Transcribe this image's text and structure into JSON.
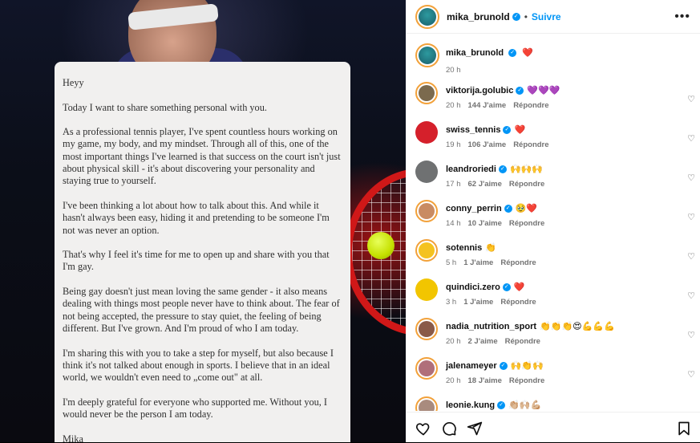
{
  "letter": {
    "greeting": "Heyy",
    "paragraphs": [
      "Today I want to share something personal with you.",
      "As a professional tennis player, I've spent countless hours working on my game, my body, and my mindset. Through all of this, one of the most important things I've learned is that success on the court isn't just about physical skill - it's about discovering your personality and staying true to yourself.",
      "I've been thinking a lot about how to talk about this. And while it hasn't always been easy, hiding it and pretending to be someone I'm not was never an option.",
      "That's why I feel it's time for me to open up and share with you that I'm gay.",
      "Being gay doesn't just mean loving the same gender - it also means dealing with things most people never have to think about. The fear of not being accepted, the pressure to stay quiet, the feeling of being different. But I've grown. And I'm proud of who I am today.",
      "I'm sharing this with you to take a step for myself, but also because I think it's not talked about enough in sports. I believe that in an ideal world, we wouldn't even need to „come out\" at all.",
      "I'm deeply grateful for everyone who supported me. Without you, I would never be the person I am today."
    ],
    "signature": "Mika"
  },
  "header": {
    "username": "mika_brunold",
    "separator": "•",
    "follow_label": "Suivre",
    "more_label": "•••"
  },
  "caption": {
    "username": "mika_brunold",
    "text": "❤️",
    "time": "20 h"
  },
  "comments": [
    {
      "username": "viktorija.golubic",
      "text": "💜💜💜",
      "time": "20 h",
      "likes": "144 J'aime",
      "reply": "Répondre",
      "verified": true,
      "avatar_color": "#7b6a4e"
    },
    {
      "username": "swiss_tennis",
      "text": "❤️",
      "time": "19 h",
      "likes": "106 J'aime",
      "reply": "Répondre",
      "verified": true,
      "avatar_color": "#d5202b"
    },
    {
      "username": "leandroriedi",
      "text": "🙌🙌🙌",
      "time": "17 h",
      "likes": "62 J'aime",
      "reply": "Répondre",
      "verified": true,
      "avatar_color": "#6f7172"
    },
    {
      "username": "conny_perrin",
      "text": "🥹❤️",
      "time": "14 h",
      "likes": "10 J'aime",
      "reply": "Répondre",
      "verified": true,
      "avatar_color": "#c98b62"
    },
    {
      "username": "sotennis",
      "text": "👏",
      "time": "5 h",
      "likes": "1 J'aime",
      "reply": "Répondre",
      "verified": false,
      "avatar_color": "#f4c21f"
    },
    {
      "username": "quindici.zero",
      "text": "❤️",
      "time": "3 h",
      "likes": "1 J'aime",
      "reply": "Répondre",
      "verified": true,
      "avatar_color": "#f2c500"
    },
    {
      "username": "nadia_nutrition_sport",
      "text": "👏👏👏😍💪💪💪",
      "time": "20 h",
      "likes": "2 J'aime",
      "reply": "Répondre",
      "verified": false,
      "avatar_color": "#8a5a48"
    },
    {
      "username": "jalenameyer",
      "text": "🙌👏🙌",
      "time": "20 h",
      "likes": "18 J'aime",
      "reply": "Répondre",
      "verified": true,
      "avatar_color": "#b06f7a"
    },
    {
      "username": "leonie.kung",
      "text": "👏🏼🙌🏼💪🏼",
      "time": "",
      "likes": "",
      "reply": "",
      "verified": true,
      "avatar_color": "#a98b7e"
    }
  ],
  "icons": {
    "like": "heart-outline-icon",
    "comment": "comment-icon",
    "share": "send-icon",
    "save": "bookmark-icon"
  },
  "colors": {
    "accent": "#0095f6",
    "meta_text": "#737373"
  }
}
